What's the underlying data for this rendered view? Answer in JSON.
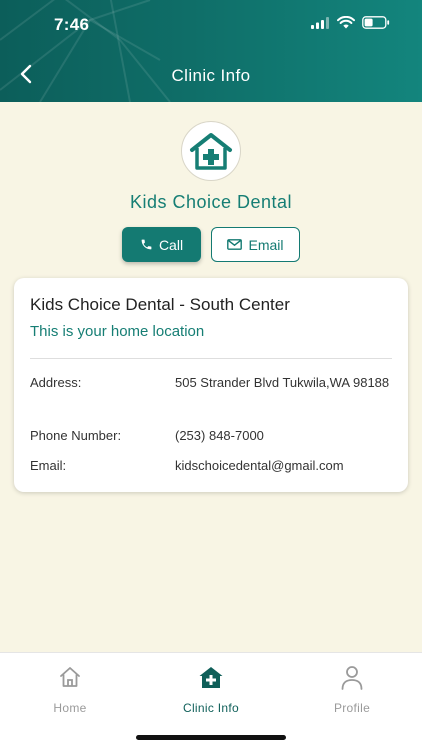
{
  "status_bar": {
    "time": "7:46"
  },
  "header": {
    "title": "Clinic Info"
  },
  "clinic": {
    "name": "Kids Choice Dental"
  },
  "actions": {
    "call_label": "Call",
    "email_label": "Email"
  },
  "card": {
    "title": "Kids Choice Dental - South Center",
    "subtitle": "This is your home location",
    "rows": [
      {
        "label": "Address:",
        "value": "505 Strander Blvd  Tukwila,WA 98188"
      },
      {
        "label": "Phone Number:",
        "value": "(253) 848-7000"
      },
      {
        "label": "Email:",
        "value": "kidschoicedental@gmail.com"
      }
    ]
  },
  "tabs": [
    {
      "label": "Home",
      "icon": "home-icon",
      "active": false
    },
    {
      "label": "Clinic Info",
      "icon": "clinic-icon",
      "active": true
    },
    {
      "label": "Profile",
      "icon": "profile-icon",
      "active": false
    }
  ],
  "colors": {
    "brand": "#147a72",
    "background": "#f8f5e4",
    "header": "#0f6e68"
  }
}
